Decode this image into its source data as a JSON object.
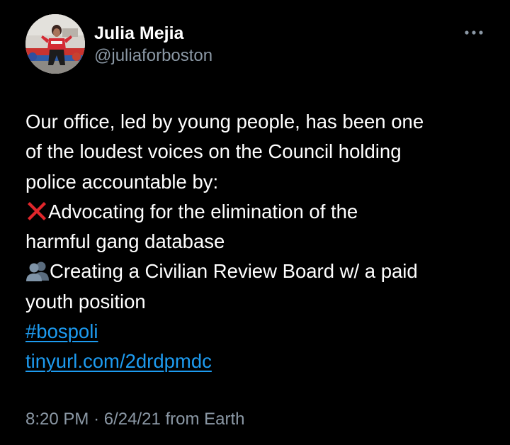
{
  "author": {
    "display_name": "Julia Mejia",
    "handle": "@juliaforboston",
    "avatar_icon": "profile-photo"
  },
  "tweet": {
    "lines": [
      "Our office, led by young people, has been one",
      "of the loudest voices on the Council holding",
      "police accountable by:",
      "Advocating for the elimination of the",
      "harmful gang database",
      "Creating a Civilian Review Board w/ a paid",
      "youth position"
    ],
    "hashtag": "#bospoli",
    "link": "tinyurl.com/2drdpmdc",
    "emoji_1": "cross-mark-icon",
    "emoji_2": "busts-in-silhouette-icon"
  },
  "meta": {
    "time": "8:20 PM",
    "separator": "·",
    "date": "6/24/21",
    "source": "from Earth"
  },
  "actions": {
    "more_icon": "more-options-icon"
  },
  "colors": {
    "background": "#000000",
    "text": "#ffffff",
    "secondary": "#8b98a5",
    "link": "#1d9bf0",
    "cross": "#e0262b"
  }
}
